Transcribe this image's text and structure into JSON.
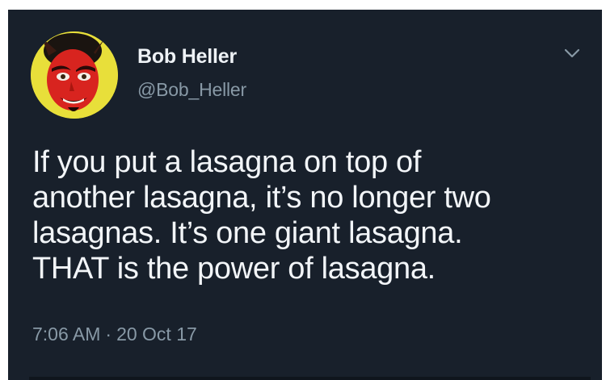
{
  "tweet": {
    "author": {
      "name": "Bob Heller",
      "handle": "@Bob_Heller",
      "avatar": "red-devil-face-avatar"
    },
    "text": "If you put a lasagna on top of\nanother lasagna, it’s no longer two\nlasagnas. It’s one giant lasagna.\nTHAT is the power of lasagna.",
    "time": "7:06 AM",
    "separator": "·",
    "date": "20 Oct 17",
    "menu_icon": "chevron-down-icon"
  },
  "colors": {
    "background": "#18202b",
    "primary_text": "#f2f5f8",
    "secondary_text": "#8899a6",
    "avatar_ring": "#e8df3a",
    "avatar_face": "#d8241f"
  }
}
